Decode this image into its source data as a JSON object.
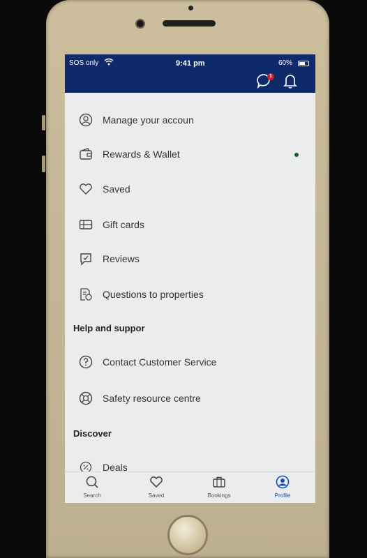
{
  "status": {
    "carrier": "SOS only",
    "time": "9:41 pm",
    "battery": "60%"
  },
  "header": {
    "notification_badge": "1"
  },
  "menu": [
    {
      "label": "Manage your accoun",
      "icon": "person-circle-icon"
    },
    {
      "label": "Rewards & Wallet",
      "icon": "wallet-icon"
    },
    {
      "label": "Saved",
      "icon": "heart-icon"
    },
    {
      "label": "Gift cards",
      "icon": "gift-card-icon"
    },
    {
      "label": "Reviews",
      "icon": "reviews-icon"
    },
    {
      "label": "Questions to properties",
      "icon": "question-document-icon"
    }
  ],
  "sections": {
    "help": "Help and suppor",
    "discover": "Discover"
  },
  "help_items": [
    {
      "label": "Contact Customer Service",
      "icon": "question-circle-icon"
    },
    {
      "label": "Safety resource centre",
      "icon": "life-buoy-icon"
    }
  ],
  "discover_items": [
    {
      "label": "Deals",
      "icon": "discount-tag-icon"
    }
  ],
  "tabs": [
    {
      "label": "Search",
      "icon": "search-icon"
    },
    {
      "label": "Saved",
      "icon": "heart-icon"
    },
    {
      "label": "Bookings",
      "icon": "briefcase-icon"
    },
    {
      "label": "Profile",
      "icon": "profile-icon",
      "active": true
    }
  ],
  "colors": {
    "header_bg": "#0f2a6b",
    "screen_bg": "#ebecee",
    "active_tab": "#0f4fb5",
    "badge": "#cc1f2a"
  }
}
